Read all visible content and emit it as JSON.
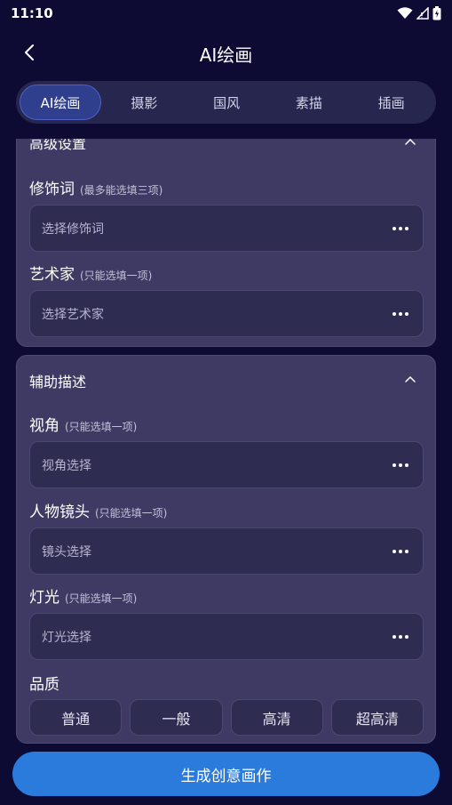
{
  "status": {
    "time": "11:10"
  },
  "header": {
    "title": "AI绘画"
  },
  "tabs": [
    {
      "label": "AI绘画",
      "active": true
    },
    {
      "label": "摄影"
    },
    {
      "label": "国风"
    },
    {
      "label": "素描"
    },
    {
      "label": "插画"
    }
  ],
  "advanced": {
    "title": "高级设置",
    "modifier": {
      "label": "修饰词",
      "hint": "(最多能选填三项)",
      "placeholder": "选择修饰词"
    },
    "artist": {
      "label": "艺术家",
      "hint": "(只能选填一项)",
      "placeholder": "选择艺术家"
    }
  },
  "assist": {
    "title": "辅助描述",
    "view": {
      "label": "视角",
      "hint": "(只能选填一项)",
      "placeholder": "视角选择"
    },
    "lens": {
      "label": "人物镜头",
      "hint": "(只能选填一项)",
      "placeholder": "镜头选择"
    },
    "light": {
      "label": "灯光",
      "hint": "(只能选填一项)",
      "placeholder": "灯光选择"
    },
    "quality": {
      "label": "品质",
      "options": [
        "普通",
        "一般",
        "高清",
        "超高清"
      ]
    }
  },
  "generate_label": "生成创意画作",
  "colors": {
    "background": "#0d0b33",
    "card": "#3e3a63",
    "accent": "#2b7bdc"
  }
}
